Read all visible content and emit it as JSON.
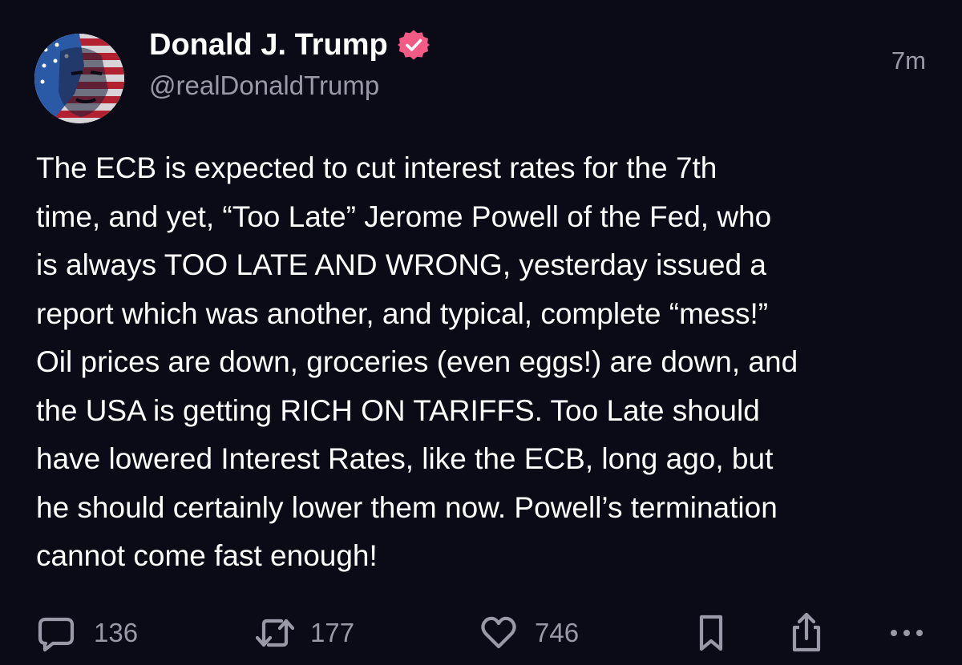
{
  "post": {
    "author": {
      "display_name": "Donald J. Trump",
      "handle": "@realDonaldTrump",
      "verified": true,
      "verified_badge_icon": "verified-badge-icon"
    },
    "timestamp": "7m",
    "body": "The ECB is expected to cut interest rates for the 7th\ntime, and yet, “Too Late” Jerome Powell of the Fed, who\nis always TOO LATE AND WRONG, yesterday issued a\nreport which was another, and typical, complete “mess!”\nOil prices are down, groceries (even eggs!) are down, and\nthe USA is getting RICH ON TARIFFS. Too Late should\nhave lowered Interest Rates, like the ECB, long ago, but\nhe should certainly lower them now. Powell’s termination\ncannot come fast enough!",
    "actions": {
      "replies": {
        "icon": "reply-icon",
        "count": "136"
      },
      "reposts": {
        "icon": "repost-icon",
        "count": "177"
      },
      "likes": {
        "icon": "heart-icon",
        "count": "746"
      },
      "bookmark": {
        "icon": "bookmark-icon"
      },
      "share": {
        "icon": "share-icon"
      },
      "more": {
        "icon": "more-icon"
      }
    }
  },
  "colors": {
    "background": "#0b0a17",
    "text_primary": "#ffffff",
    "text_secondary": "#9a99a8",
    "verified_badge": "#f35a84"
  }
}
